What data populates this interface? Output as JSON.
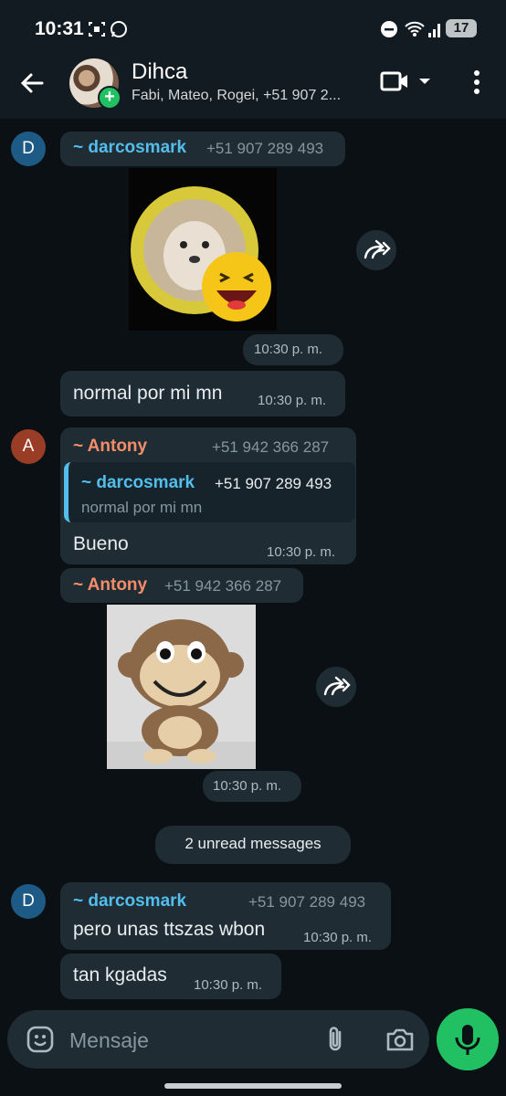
{
  "status_bar": {
    "time": "10:31",
    "battery": "17",
    "icons": [
      "screenshot-icon",
      "whatsapp-icon",
      "dnd-icon",
      "wifi-icon",
      "signal-icon",
      "battery-icon"
    ]
  },
  "header": {
    "title": "Dihca",
    "subtitle": "Fabi, Mateo, Rogei, +51 907 2..."
  },
  "messages": [
    {
      "type": "sticker",
      "avatar_letter": "D",
      "sender": "~ darcosmark",
      "phone": "+51 907 289 493",
      "time": "10:30 p. m.",
      "name_color": "#53bdeb",
      "avatar_color": "#1d5a86"
    },
    {
      "type": "text",
      "text": "normal por mi mn",
      "time": "10:30 p. m."
    },
    {
      "type": "reply",
      "avatar_letter": "A",
      "sender": "~ Antony",
      "phone": "+51 942 366 287",
      "quote_sender": "~ darcosmark",
      "quote_phone": "+51 907 289 493",
      "quote_text": "normal por mi mn",
      "text": "Bueno",
      "time": "10:30 p. m.",
      "name_color": "#f58d6a",
      "avatar_color": "#9a3d26"
    },
    {
      "type": "sticker",
      "sender": "~ Antony",
      "phone": "+51 942 366 287",
      "time": "10:30 p. m."
    },
    {
      "type": "text_with_header",
      "avatar_letter": "D",
      "sender": "~ darcosmark",
      "phone": "+51 907 289 493",
      "text": "pero unas ttszas wbon",
      "time": "10:30 p. m."
    },
    {
      "type": "text",
      "text": "tan kgadas",
      "time": "10:30 p. m."
    }
  ],
  "unread_label": "2 unread messages",
  "composer": {
    "placeholder": "Mensaje"
  },
  "colors": {
    "accent": "#21c063",
    "bubble": "#1f2c34",
    "background": "#0b1014"
  }
}
